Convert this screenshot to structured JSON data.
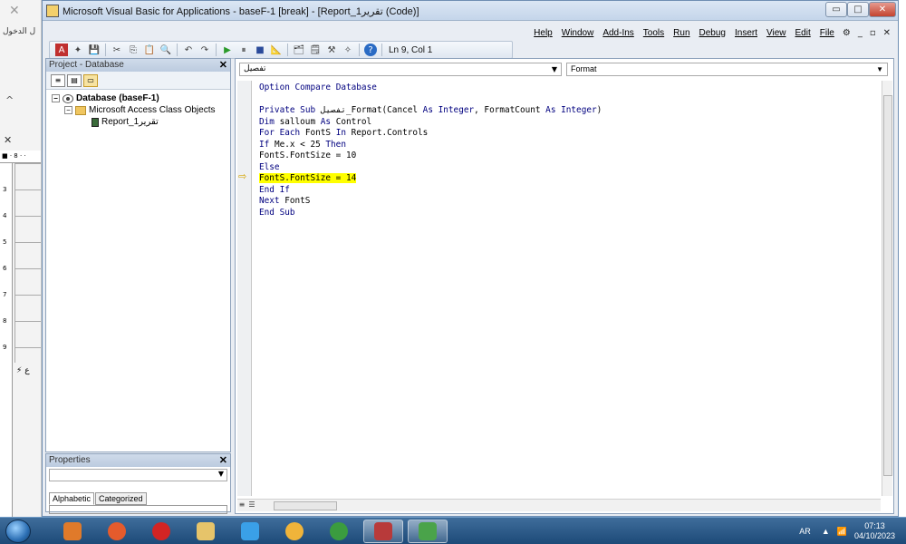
{
  "background_window": {
    "close_glyph": "✕",
    "login_label": "ل الدخول",
    "caret": "^",
    "x_glyph": "✕",
    "ruler_top_text": "■ · 8 · ·",
    "ruler_numbers": [
      "3",
      "4",
      "5",
      "6",
      "7",
      "8",
      "9"
    ],
    "footer_text": "⚡ ع"
  },
  "window": {
    "title": "Microsoft Visual Basic for Applications - baseF-1 [break] - [Report_1تقرير (Code)]",
    "min_glyph": "▭",
    "max_glyph": "□",
    "close_glyph": "✕"
  },
  "menubar": {
    "items": [
      "Help",
      "Window",
      "Add-Ins",
      "Tools",
      "Run",
      "Debug",
      "Insert",
      "View",
      "Edit",
      "File"
    ],
    "mdi_controls": [
      "_",
      "▫",
      "✕"
    ]
  },
  "toolbar": {
    "cursor_position": "Ln 9, Col 1"
  },
  "project_pane": {
    "title": "Project - Database",
    "close_glyph": "✕",
    "tree": [
      {
        "label": "Database (baseF-1)",
        "level": 0,
        "icon": "database-icon",
        "expanded": true
      },
      {
        "label": "Microsoft Access Class Objects",
        "level": 1,
        "icon": "folder-icon",
        "expanded": true
      },
      {
        "label": "Report_1تقرير",
        "level": 2,
        "icon": "report-icon"
      }
    ]
  },
  "properties_pane": {
    "title": "Properties",
    "close_glyph": "✕",
    "tabs": [
      "Alphabetic",
      "Categorized"
    ],
    "selected_tab": "Alphabetic"
  },
  "code_window": {
    "object_combo": "تفصيل",
    "procedure_combo": "Format",
    "current_line_index": 8,
    "lines": [
      "Option Compare Database",
      "",
      "Private Sub تفصيل_Format(Cancel As Integer, FormatCount As Integer)",
      "Dim salloum As Control",
      "For Each FontS In Report.Controls",
      "If Me.x < 25 Then",
      "FontS.FontSize = 10",
      "Else",
      "FontS.FontSize = 14",
      "End If",
      "Next FontS",
      "End Sub"
    ]
  },
  "taskbar": {
    "apps": [
      {
        "name": "media-player",
        "color": "#e07a2a"
      },
      {
        "name": "firefox",
        "color": "#e55b2c"
      },
      {
        "name": "opera",
        "color": "#d32424"
      },
      {
        "name": "file-explorer",
        "color": "#e6c46a"
      },
      {
        "name": "internet-explorer",
        "color": "#3aa0e8"
      },
      {
        "name": "download-manager",
        "color": "#f0b43a"
      },
      {
        "name": "chrome",
        "color": "#3b9c3f"
      },
      {
        "name": "access",
        "color": "#b83a3a"
      },
      {
        "name": "network-app",
        "color": "#4aa34a"
      }
    ],
    "language": "AR",
    "time": "07:13",
    "date": "04/10/2023"
  },
  "colors": {
    "highlight": "#ffff00",
    "keyword": "#00007f",
    "taskbar": "#2a5888"
  }
}
